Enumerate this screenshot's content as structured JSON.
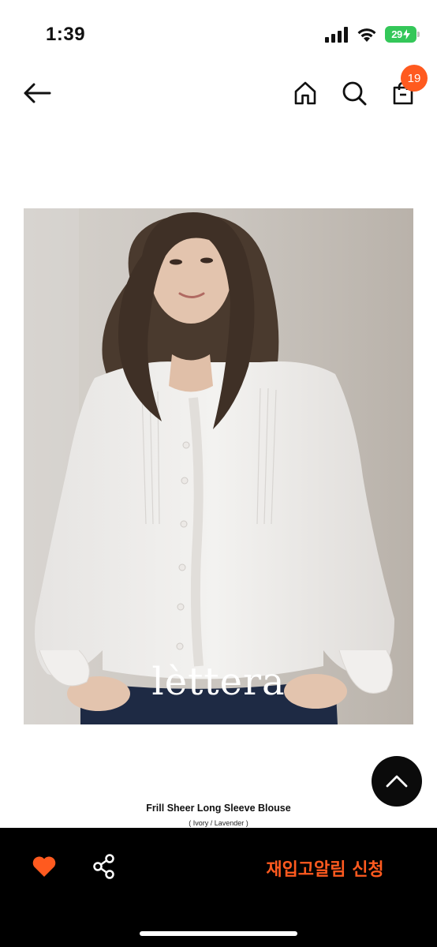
{
  "status_bar": {
    "time": "1:39",
    "battery": "29"
  },
  "nav": {
    "cart_count": "19"
  },
  "product": {
    "brand": "lèttera",
    "name": "Frill Sheer Long Sleeve Blouse",
    "options": "( Ivory / Lavender )"
  },
  "actions": {
    "restock_label": "재입고알림 신청"
  },
  "colors": {
    "accent": "#ff5a1f",
    "bottom_bar": "#000000"
  },
  "icons": [
    "back-arrow-icon",
    "home-icon",
    "search-icon",
    "cart-icon",
    "heart-icon",
    "share-icon",
    "chevron-up-icon"
  ]
}
